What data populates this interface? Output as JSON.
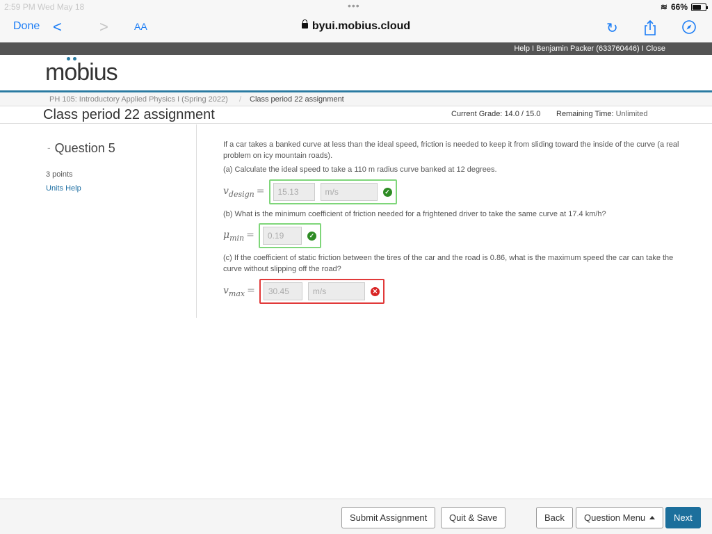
{
  "status": {
    "time": "2:59 PM  Wed May 18",
    "battery": "66%"
  },
  "browser": {
    "done": "Done",
    "back": "<",
    "forward": ">",
    "text_size": "AA",
    "url": "byui.mobius.cloud"
  },
  "topbar": {
    "links": "Help I Benjamin Packer (633760446) I Close"
  },
  "logo": {
    "text": "mobius"
  },
  "breadcrumb": {
    "course": "PH 105: Introductory Applied Physics I (Spring 2022)",
    "sep": "/",
    "current": "Class period 22 assignment"
  },
  "page": {
    "title": "Class period 22 assignment",
    "grade_label": "Current Grade:",
    "grade": "14.0 / 15.0",
    "remaining_label": "Remaining Time:",
    "remaining": "Unlimited"
  },
  "question": {
    "title": "Question 5",
    "points": "3 points",
    "units_help": "Units Help",
    "intro": "If a car takes a banked curve at less than the ideal speed, friction is needed to keep it from sliding toward the inside of the curve (a real problem on icy mountain roads).",
    "part_a": "(a) Calculate the ideal speed to take a 110 m radius curve banked at 12 degrees.",
    "part_b": "(b) What is the minimum coefficient of friction needed for a frightened driver to take the same curve at 17.4 km/h?",
    "part_c": "(c) If the coefficient of static friction between the tires of the car and the road is 0.86, what is the maximum speed the car can take the curve without slipping off the road?",
    "a_var": "v",
    "a_sub": "design",
    "a_value": "15.13",
    "a_unit": "m/s",
    "b_var": "μ",
    "b_sub": "min",
    "b_value": "0.19",
    "c_var": "v",
    "c_sub": "max",
    "c_value": "30.45",
    "c_unit": "m/s",
    "eq": "="
  },
  "footer": {
    "submit": "Submit Assignment",
    "quit": "Quit & Save",
    "back": "Back",
    "menu": "Question Menu",
    "next": "Next"
  },
  "colors": {
    "accent": "#2a7aa1",
    "correct": "#2e8b24",
    "incorrect": "#d92525"
  }
}
